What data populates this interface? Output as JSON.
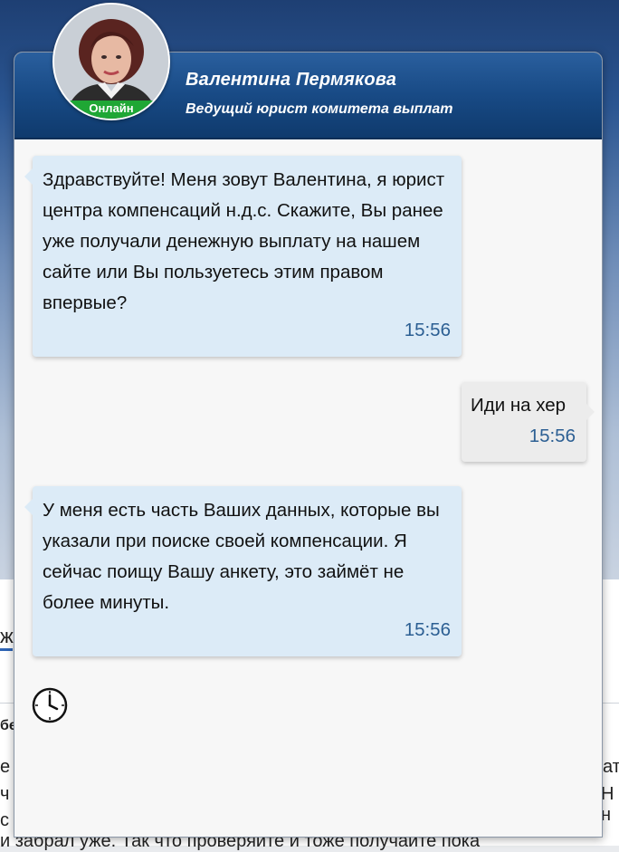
{
  "agent": {
    "name": "Валентина Пермякова",
    "role": "Ведущий юрист комитета выплат",
    "status": "Онлайн"
  },
  "messages": [
    {
      "direction": "incoming",
      "text": "Здравствуйте! Меня зовут Валентина, я юрист центра компенсаций н.д.с. Скажите, Вы ранее уже получали денежную выплату на нашем сайте или Вы пользуетесь этим правом впервые?",
      "time": "15:56"
    },
    {
      "direction": "outgoing",
      "text": "Иди на хер",
      "time": "15:56"
    },
    {
      "direction": "incoming",
      "text": "У меня есть часть Ваших данных, которые вы указали при поиске своей компенсации. Я сейчас поищу Вашу анкету, это займёт не более минуты.",
      "time": "15:56"
    }
  ],
  "typing_indicator": {
    "icon": "clock-icon"
  },
  "background_page": {
    "tab_fragment": "ж",
    "text_fragments": [
      "бе",
      "е",
      "ч",
      "с",
      "ат",
      "Н н",
      "и забрал уже. Так что проверяйте и тоже получайте пока"
    ]
  },
  "colors": {
    "header_dark": "#0f3a6d",
    "header_light": "#2a5f9e",
    "incoming_bubble": "#dcebf7",
    "outgoing_bubble": "#ececec",
    "timestamp": "#2c5f93",
    "online_badge": "#1fa735"
  }
}
